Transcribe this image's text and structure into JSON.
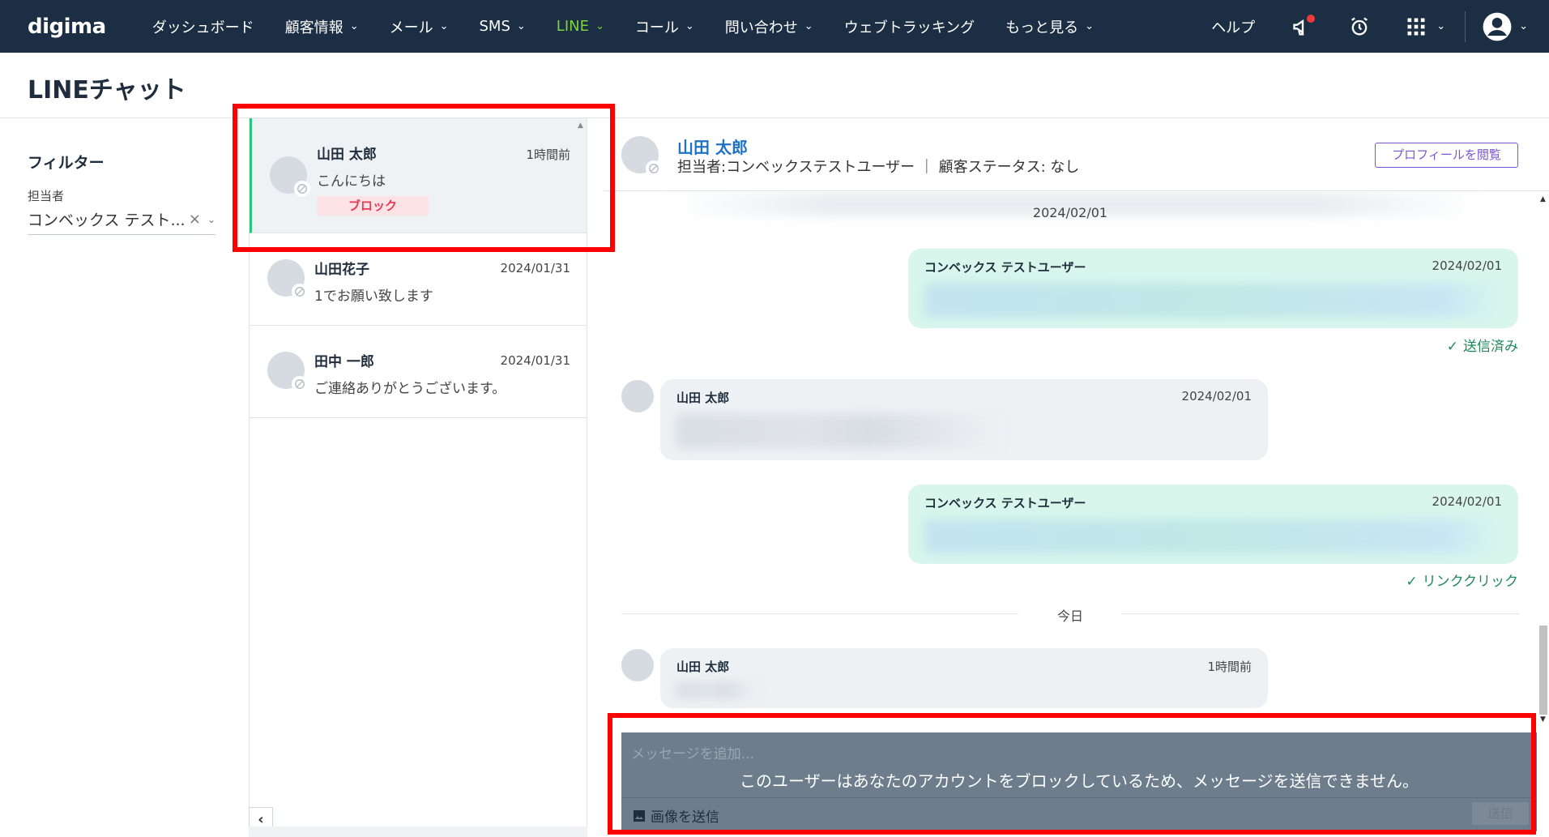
{
  "nav": {
    "logo": "digima",
    "items": [
      {
        "label": "ダッシュボード",
        "dropdown": false
      },
      {
        "label": "顧客情報",
        "dropdown": true
      },
      {
        "label": "メール",
        "dropdown": true
      },
      {
        "label": "SMS",
        "dropdown": true
      },
      {
        "label": "LINE",
        "dropdown": true,
        "active": true
      },
      {
        "label": "コール",
        "dropdown": true
      },
      {
        "label": "問い合わせ",
        "dropdown": true
      },
      {
        "label": "ウェブトラッキング",
        "dropdown": false
      },
      {
        "label": "もっと見る",
        "dropdown": true
      }
    ],
    "help": "ヘルプ",
    "chevron": "⌄"
  },
  "page": {
    "title": "LINEチャット"
  },
  "filter": {
    "title": "フィルター",
    "assignee_label": "担当者",
    "assignee_value": "コンベックス テスト...",
    "clear": "×"
  },
  "conversations": [
    {
      "name": "山田 太郎",
      "time": "1時間前",
      "message": "こんにちは",
      "tag": "ブロック",
      "selected": true
    },
    {
      "name": "山田花子",
      "time": "2024/01/31",
      "message": "1でお願い致します"
    },
    {
      "name": "田中 一郎",
      "time": "2024/01/31",
      "message": "ご連絡ありがとうございます。"
    }
  ],
  "chat": {
    "name": "山田 太郎",
    "sub": "担当者:コンベックステストユーザー ｜ 顧客ステータス: なし",
    "profile_button": "プロフィールを閲覧",
    "date1": "2024/02/01",
    "today": "今日",
    "messages": [
      {
        "dir": "out",
        "sender": "コンベックス テストユーザー",
        "time": "2024/02/01",
        "status": "送信済み"
      },
      {
        "dir": "in",
        "sender": "山田 太郎",
        "time": "2024/02/01"
      },
      {
        "dir": "out",
        "sender": "コンベックス テストユーザー",
        "time": "2024/02/01",
        "status": "リンククリック"
      },
      {
        "dir": "in",
        "sender": "山田 太郎",
        "time": "1時間前"
      }
    ]
  },
  "compose": {
    "placeholder": "メッセージを追加...",
    "blocked_notice": "このユーザーはあなたのアカウントをブロックしているため、メッセージを送信できません。",
    "image_button": "画像を送信",
    "send_button": "送信"
  },
  "colors": {
    "nav_bg": "#1c2e44",
    "nav_active": "#7dd33b",
    "accent_green": "#2ec37f",
    "block_tag": "#e53955",
    "link_blue": "#1f73c4",
    "profile_purple": "#7a56d6",
    "annotation_red": "#ff0000"
  }
}
